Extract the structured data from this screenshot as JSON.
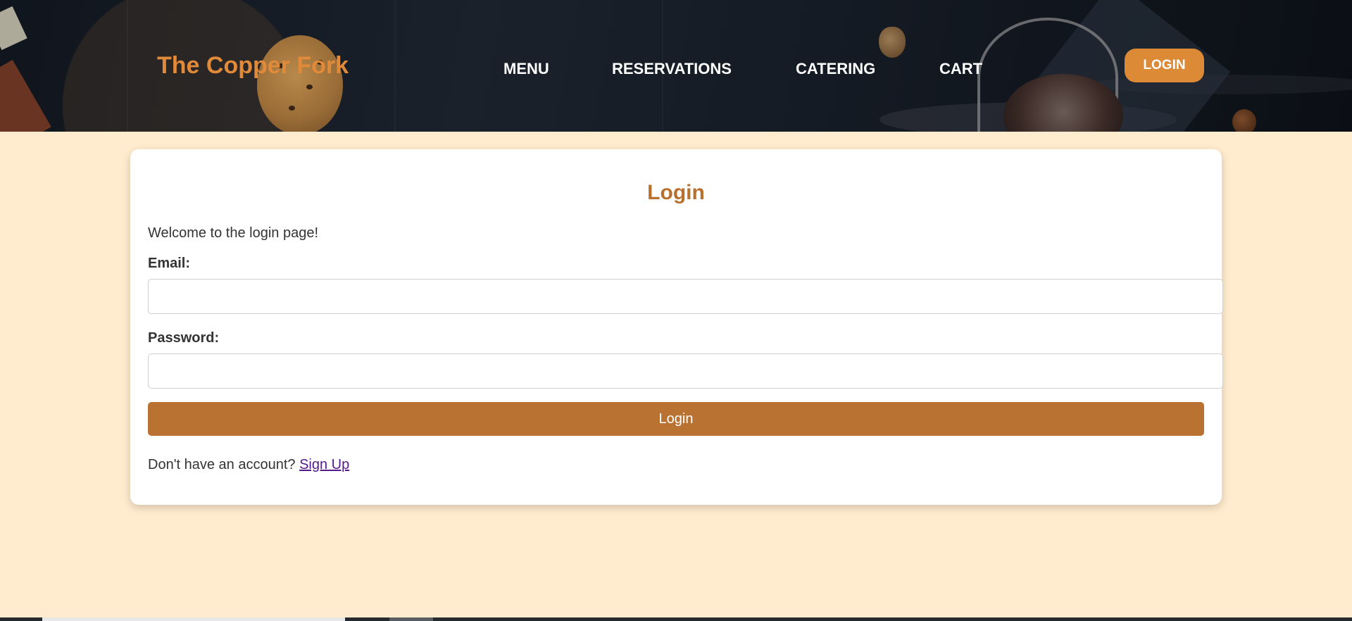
{
  "header": {
    "brand": "The Copper Fork",
    "nav": [
      {
        "label": "MENU"
      },
      {
        "label": "RESERVATIONS"
      },
      {
        "label": "CATERING"
      },
      {
        "label": "CART"
      }
    ],
    "login_button": "LOGIN"
  },
  "login_card": {
    "title": "Login",
    "welcome": "Welcome to the login page!",
    "email_label": "Email:",
    "email_value": "",
    "email_placeholder": "",
    "password_label": "Password:",
    "password_value": "",
    "password_placeholder": "",
    "submit_label": "Login",
    "signup_prompt": "Don't have an account?",
    "signup_link": "Sign Up"
  },
  "colors": {
    "accent": "#dc8a36",
    "title": "#b8702f",
    "button": "#b97232",
    "page_background": "#ffebcd",
    "link": "#551a8b"
  }
}
